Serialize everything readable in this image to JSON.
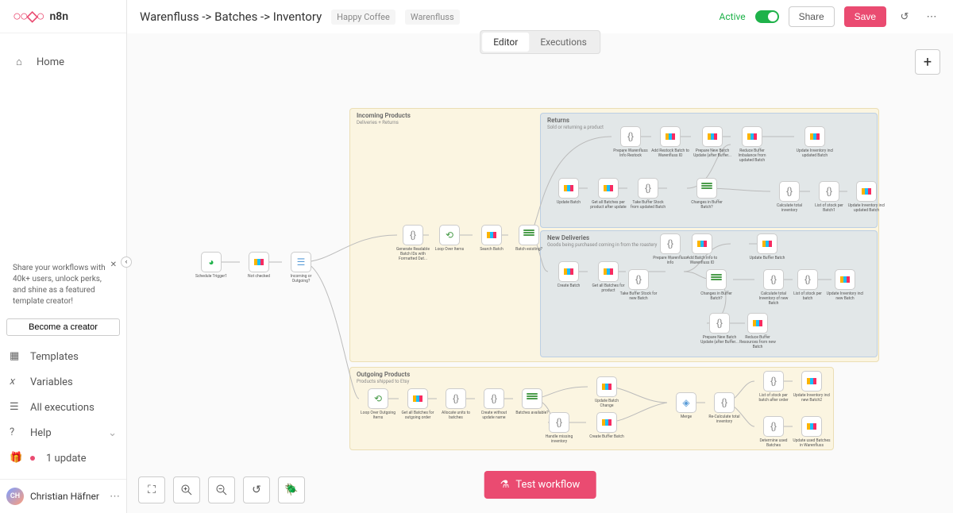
{
  "logo": "n8n",
  "nav": {
    "home": "Home"
  },
  "banner": {
    "text": "Share your workflows with 40k+ users, unlock perks, and shine as a featured template creator!",
    "cta": "Become a creator"
  },
  "lower_nav": {
    "templates": "Templates",
    "variables": "Variables",
    "executions": "All executions",
    "help": "Help",
    "update": "1 update"
  },
  "user": {
    "initials": "CH",
    "name": "Christian Häfner"
  },
  "workflow": {
    "title": "Warenfluss -> Batches -> Inventory",
    "tags": [
      "Happy Coffee",
      "Warenfluss"
    ]
  },
  "toolbar": {
    "active": "Active",
    "share": "Share",
    "save": "Save"
  },
  "tabs": {
    "editor": "Editor",
    "executions": "Executions"
  },
  "test_button": "Test workflow",
  "groups": {
    "incoming": {
      "title": "Incoming Products",
      "sub": "Deliveries + Returns"
    },
    "returns": {
      "title": "Returns",
      "sub": "Sold or returning a product"
    },
    "newdeliv": {
      "title": "New Deliveries",
      "sub": "Goods being purchased coming in from the roastery"
    },
    "outgoing": {
      "title": "Outgoing Products",
      "sub": "Products shipped to Etsy"
    }
  },
  "nodes": {
    "trigger": "Schedule Trigger1",
    "notchecked": "Not checked",
    "incout": "Incoming or Outgoing?",
    "genlist": "Generate Readable Batch IDs with Formatted Dat...",
    "loopitems": "Loop Over Items",
    "searchbatch": "Search Batch",
    "batchexists": "Batch existing?",
    "prepinfo_restock": "Prepare Warenfluss Info Restock",
    "addrestock": "Add Restock Batch to Warenfluss ID",
    "prepnewbatch": "Prepare New Batch Update (after Buffer...",
    "reducebuf": "Reduce Buffer Imbalance from updated Batch",
    "updateinv_up": "Update Inventory incl updated Batch",
    "updatebatch": "Update Batch",
    "getallbatch1": "Get all Batches per product after update",
    "takebuf": "Take Buffer Stock from updated Batch",
    "changesbuf1": "Changes in Buffer Batch?",
    "calctotal1": "Calculate total inventory",
    "liststock1": "List of stock per Batch1",
    "updateinv_upd": "Update Inventory incl updated Batch",
    "prepinfonew": "Prepare Warenfluss info",
    "addbatchinfo": "Add Batch info to Warenfluss ID",
    "updatebuf": "Update Buffer Batch",
    "createbatch": "Create Batch",
    "getallbatch2": "Get all Batches for product",
    "takebuf2": "Take Buffer Stock for new Batch",
    "changesbuf2": "Changes in Buffer Batch?",
    "calctotal2": "Calculate total Inventory of new Batch",
    "liststock2": "List of stock per batch",
    "updateinv_new": "Update Inventory incl new Batch",
    "prepnewbatch2": "Prepare New Batch Update (after Buffer...",
    "reducebuf2": "Reduce Buffer Resources from new Batch",
    "loopout": "Loop Over Outgoing Items",
    "getallout": "Get all Batches for outgoing order",
    "allocate": "Allocate units to batches",
    "createwo": "Create without update name",
    "batchesavail": "Batches available?",
    "updatechg": "Update Batch Change",
    "handlemiss": "Handle missing inventory",
    "createbuf": "Create Buffer Batch",
    "merge": "Merge",
    "recalc": "Re-Calculate total inventory",
    "liststockafter": "List of stock per batch after order",
    "updateinvnew2": "Update Inventory incl new Batch2",
    "detused": "Determine used Batches",
    "updateused": "Update used Batches in Warenfluss"
  }
}
